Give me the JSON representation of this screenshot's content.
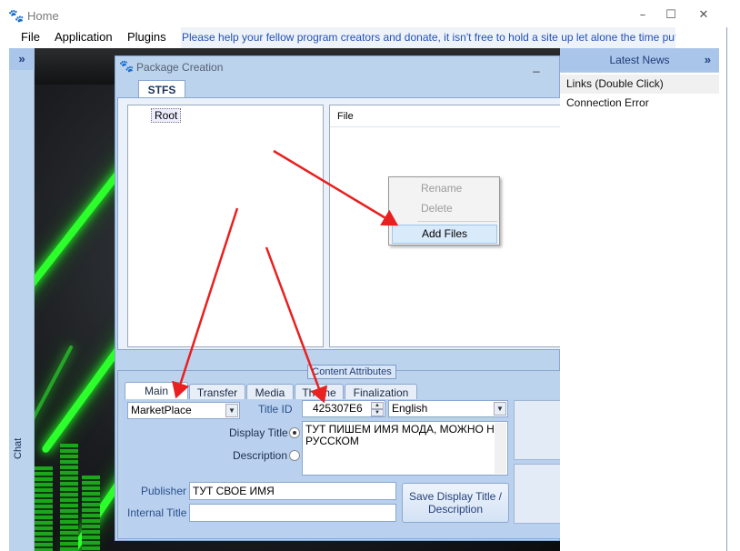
{
  "window": {
    "title": "Home",
    "icon": "paw-icon",
    "minimize": "–",
    "maximize": "☐",
    "close": "✕"
  },
  "menu": {
    "items": [
      "File",
      "Application",
      "Plugins"
    ],
    "donate_text": "Please help your fellow program creators and donate, it isn't free to hold a site up let alone the time put into this"
  },
  "left_strip": {
    "chevron": "»",
    "chat_label": "Chat"
  },
  "package_dialog": {
    "title": "Package Creation",
    "minimize": "_",
    "tab": "STFS",
    "tree_root": "Root",
    "file_column": "File",
    "context_menu": {
      "items": [
        "Rename",
        "Delete",
        "Add Files"
      ],
      "disabled": [
        "Rename",
        "Delete"
      ],
      "highlighted": "Add Files"
    },
    "content_attributes": {
      "label": "Content Attributes",
      "tabs": [
        "Main",
        "Transfer",
        "Media",
        "Theme",
        "Finalization"
      ],
      "active_tab": "Main",
      "package_type": "MarketPlace",
      "title_id_label": "Title ID",
      "title_id_value": "425307E6",
      "language": "English",
      "display_title_label": "Display Title",
      "description_label": "Description",
      "display_title_value": "ТУТ ПИШЕМ ИМЯ МОДА, МОЖНО НА РУССКОМ",
      "selected_field": "Display Title",
      "publisher_label": "Publisher",
      "publisher_value": "ТУТ СВОЕ ИМЯ",
      "internal_title_label": "Internal Title",
      "internal_title_value": "",
      "save_button": "Save Display Title / Description"
    }
  },
  "news": {
    "title": "Latest News",
    "chevron": "»",
    "items": [
      "Links (Double Click)",
      "Connection Error"
    ],
    "selected": "Links (Double Click)"
  },
  "colors": {
    "panel_blue": "#bcd3ee",
    "donate_text": "#2350b5",
    "annotation_arrow": "#e8201f",
    "laser_green": "#2cff2c"
  }
}
